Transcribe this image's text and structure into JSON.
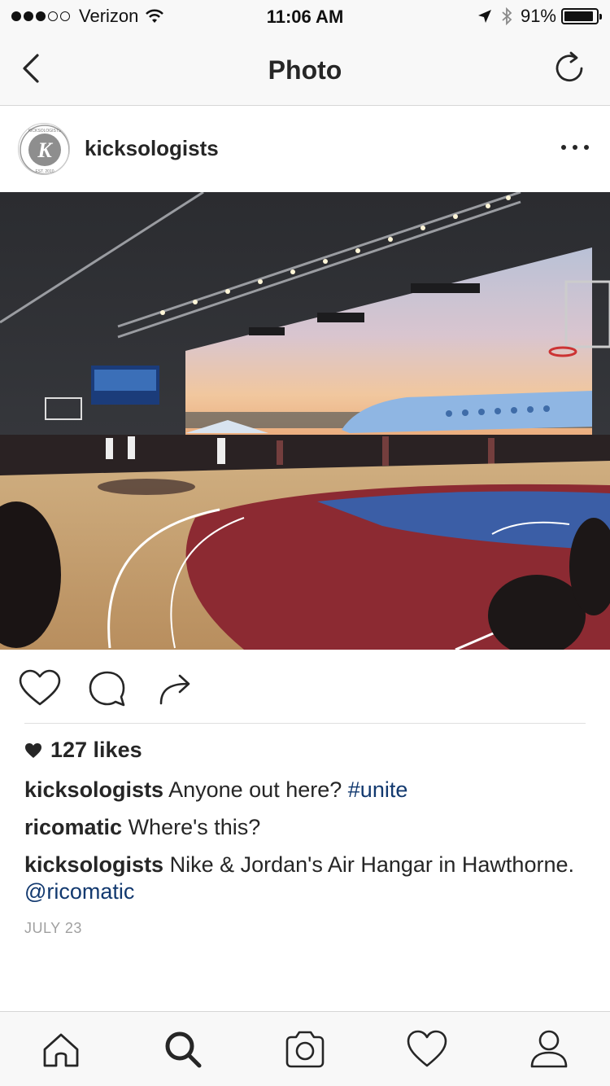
{
  "status_bar": {
    "carrier": "Verizon",
    "time": "11:06 AM",
    "battery": "91%",
    "battery_level": 0.91,
    "signal_bars_filled": 3,
    "signal_bars_total": 5
  },
  "nav": {
    "title": "Photo",
    "back_icon": "chevron-left-icon",
    "refresh_icon": "refresh-icon"
  },
  "post": {
    "username": "kicksologists",
    "avatar_text_top": "KICKSOLOGISTS",
    "avatar_letter": "K",
    "avatar_text_bottom": "EST. 2010",
    "photo_alt_icon": "basketball-court-photo"
  },
  "actions": {
    "like_icon": "heart-icon",
    "comment_icon": "comment-icon",
    "share_icon": "share-icon"
  },
  "likes": {
    "count_label": "127 likes"
  },
  "comments": [
    {
      "author": "kicksologists",
      "text": "Anyone out here?",
      "tag": "#unite"
    },
    {
      "author": "ricomatic",
      "text": "Where's this?"
    },
    {
      "author": "kicksologists",
      "text": "Nike & Jordan's Air Hangar in Hawthorne.",
      "tag": "@ricomatic"
    }
  ],
  "date": "JULY 23",
  "colors": {
    "link": "#12396f",
    "text": "#262626",
    "bar_background": "#f8f8f8"
  },
  "tab_bar": {
    "items": [
      "home-icon",
      "search-icon",
      "camera-icon",
      "heart-icon",
      "profile-icon"
    ],
    "active": "search-icon"
  }
}
